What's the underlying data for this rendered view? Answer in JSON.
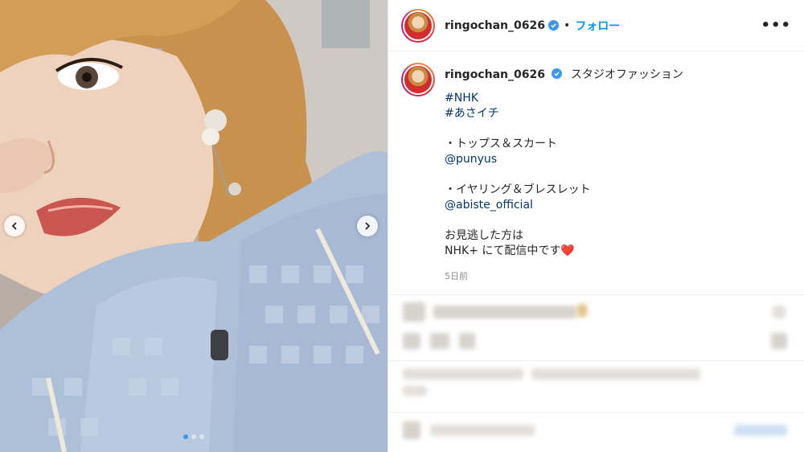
{
  "post": {
    "username": "ringochan_0626",
    "separator": "•",
    "follow_label": "フォロー",
    "more_label": "•••",
    "caption_title": "スタジオファッション",
    "caption_lines": [
      {
        "text": "#NHK",
        "kind": "tag"
      },
      {
        "text": "#あさイチ",
        "kind": "tag"
      },
      {
        "text": "",
        "kind": "gap"
      },
      {
        "text": "・トップス＆スカート",
        "kind": "text"
      },
      {
        "text": "@punyus",
        "kind": "tag"
      },
      {
        "text": "",
        "kind": "gap"
      },
      {
        "text": "・イヤリング＆ブレスレット",
        "kind": "text"
      },
      {
        "text": "@abiste_official",
        "kind": "tag"
      },
      {
        "text": "",
        "kind": "gap"
      },
      {
        "text": "お見逃した方は",
        "kind": "text"
      },
      {
        "text": "NHK+ にて配信中です❤️",
        "kind": "text"
      }
    ],
    "timestamp": "5日前"
  },
  "carousel": {
    "count": 3,
    "active_index": 0
  },
  "colors": {
    "link": "#00376b",
    "follow": "#0095f6",
    "verified": "#3897f0"
  }
}
